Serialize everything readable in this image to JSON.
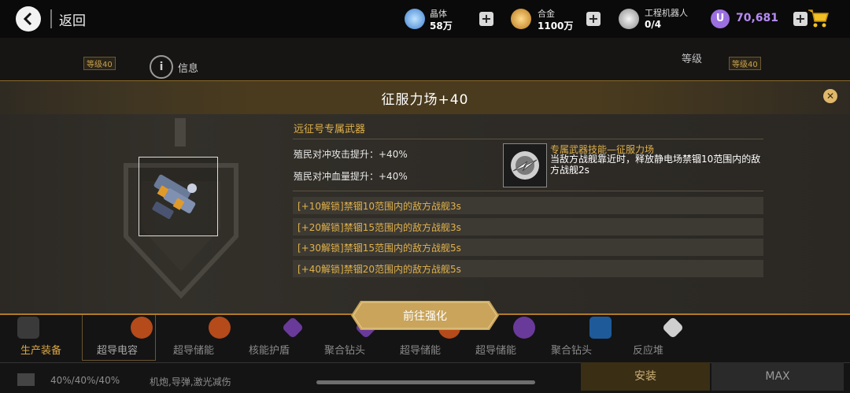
{
  "header": {
    "back_label": "返回",
    "resources": [
      {
        "name": "晶体",
        "value": "58万",
        "icon": "crystal-icon",
        "color": "#6fb7ff"
      },
      {
        "name": "合金",
        "value": "1100万",
        "icon": "alloy-icon",
        "color": "#e8a93b"
      },
      {
        "name": "工程机器人",
        "value": "0/4",
        "icon": "robot-icon",
        "color": "#dddddd"
      }
    ],
    "currency": {
      "symbol": "U",
      "value": "70,681",
      "color": "#b58cf2"
    }
  },
  "background": {
    "tag_left": "等级40",
    "tag_right": "等级40",
    "info_icon": "i",
    "info_label": "信息",
    "level_label": "等级",
    "tabs": [
      "生产装备",
      "超导电容",
      "超导储能",
      "核能护盾",
      "聚合钻头",
      "超导储能",
      "超导储能",
      "聚合钻头",
      "反应堆"
    ],
    "stat_summary": "40%/40%/40%",
    "stat_desc": "机炮,导弹,激光减伤",
    "install_label": "安装",
    "max_label": "MAX"
  },
  "modal": {
    "title": "征服力场+40",
    "close_symbol": "✕",
    "weapon_type": "远征号专属武器",
    "stats": [
      "殖民对冲攻击提升：+40%",
      "殖民对冲血量提升：+40%"
    ],
    "skill": {
      "name": "专属武器技能—征服力场",
      "description": "当敌方战舰靠近时，释放静电场禁锢10范围内的敌方战舰2s"
    },
    "unlocks": [
      "[+10解锁]禁锢10范围内的敌方战舰3s",
      "[+20解锁]禁锢15范围内的敌方战舰3s",
      "[+30解锁]禁锢15范围内的敌方战舰5s",
      "[+40解锁]禁锢20范围内的敌方战舰5s"
    ],
    "go_button": "前往强化"
  },
  "colors": {
    "accent_gold": "#e0b14a",
    "button_gold": "#c9a45a"
  }
}
